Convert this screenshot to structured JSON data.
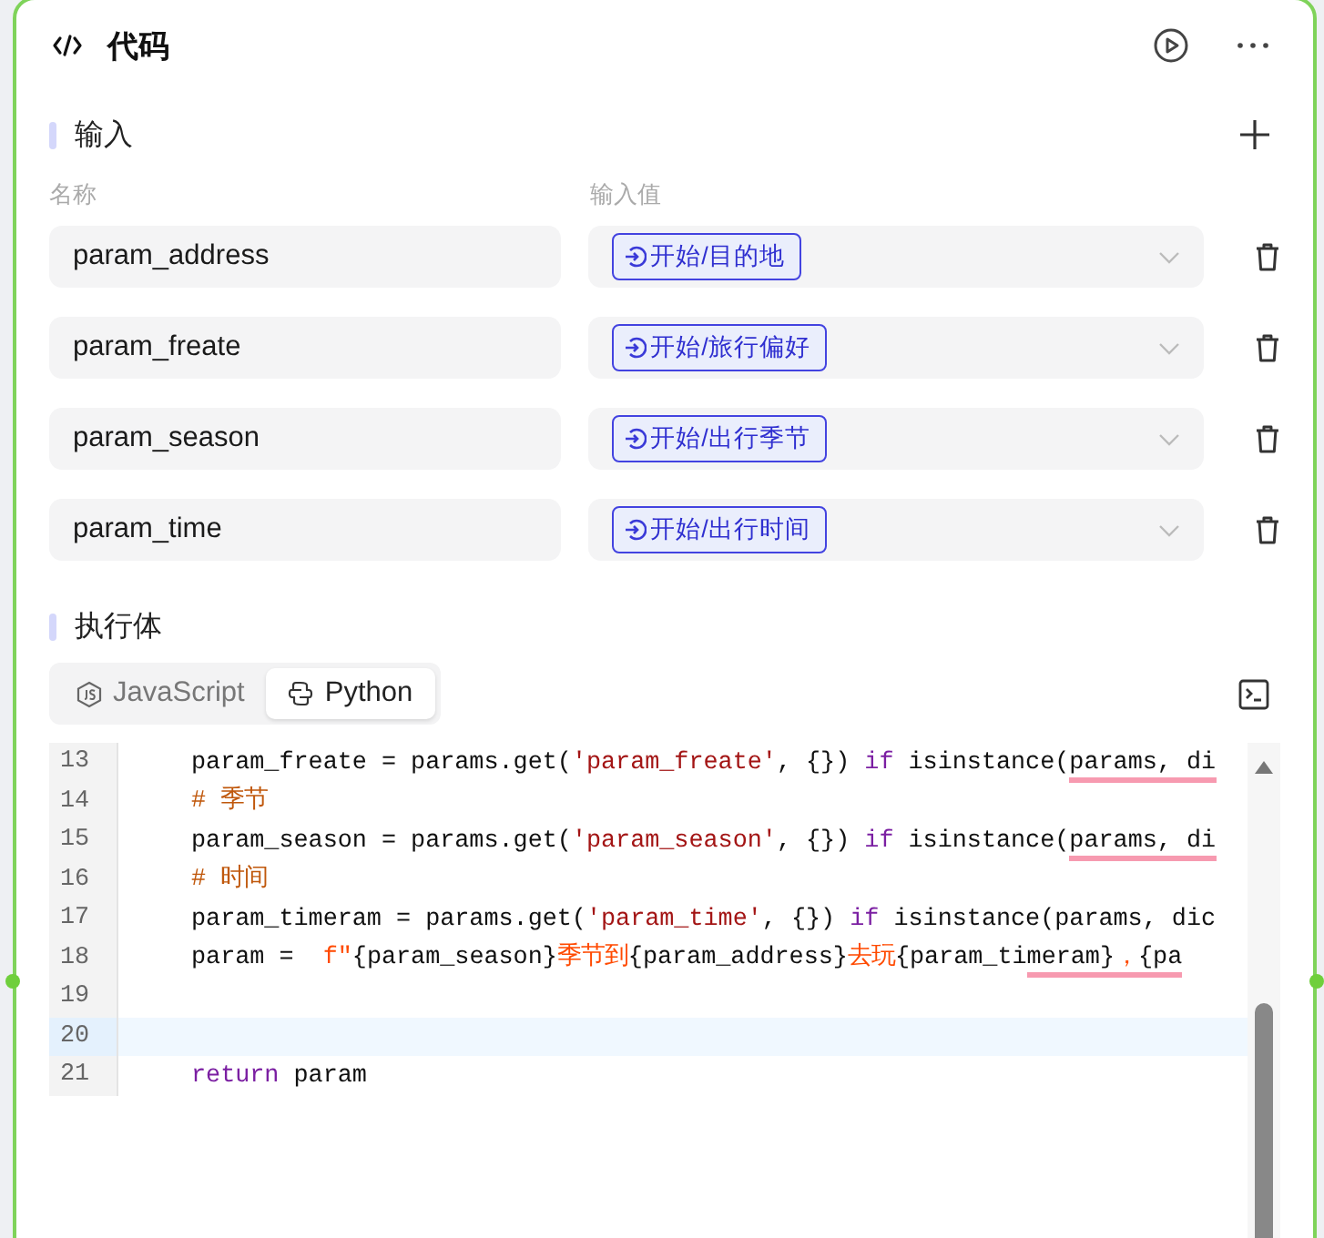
{
  "header": {
    "title": "代码"
  },
  "inputs": {
    "title": "输入",
    "columns": [
      "名称",
      "输入值"
    ],
    "rows": [
      {
        "name": "param_address",
        "value": "开始/目的地"
      },
      {
        "name": "param_freate",
        "value": "开始/旅行偏好"
      },
      {
        "name": "param_season",
        "value": "开始/出行季节"
      },
      {
        "name": "param_time",
        "value": "开始/出行时间"
      }
    ]
  },
  "body": {
    "title": "执行体",
    "tabs": [
      {
        "label": "JavaScript",
        "selected": false
      },
      {
        "label": "Python",
        "selected": true
      }
    ],
    "code": [
      {
        "number": "13",
        "active": false,
        "tokens": [
          {
            "kind": "plain",
            "text": "param_freate = params.get("
          },
          {
            "kind": "string",
            "text": "'param_freate'"
          },
          {
            "kind": "plain",
            "text": ", {}) "
          },
          {
            "kind": "keyword",
            "text": "if"
          },
          {
            "kind": "plain",
            "text": " isinstance("
          },
          {
            "kind": "plain",
            "text": "params, di",
            "flagged": true
          }
        ]
      },
      {
        "number": "14",
        "active": false,
        "tokens": [
          {
            "kind": "comment",
            "text": "# 季节"
          }
        ]
      },
      {
        "number": "15",
        "active": false,
        "tokens": [
          {
            "kind": "plain",
            "text": "param_season = params.get("
          },
          {
            "kind": "string",
            "text": "'param_season'"
          },
          {
            "kind": "plain",
            "text": ", {}) "
          },
          {
            "kind": "keyword",
            "text": "if"
          },
          {
            "kind": "plain",
            "text": " isinstance("
          },
          {
            "kind": "plain",
            "text": "params, di",
            "flagged": true
          }
        ]
      },
      {
        "number": "16",
        "active": false,
        "tokens": [
          {
            "kind": "comment",
            "text": "# 时间"
          }
        ]
      },
      {
        "number": "17",
        "active": false,
        "tokens": [
          {
            "kind": "plain",
            "text": "param_timeram = params.get("
          },
          {
            "kind": "string",
            "text": "'param_time'"
          },
          {
            "kind": "plain",
            "text": ", {}) "
          },
          {
            "kind": "keyword",
            "text": "if"
          },
          {
            "kind": "plain",
            "text": " isinstance(params, dic"
          }
        ]
      },
      {
        "number": "18",
        "active": false,
        "tokens": [
          {
            "kind": "plain",
            "text": "param =  "
          },
          {
            "kind": "fstring",
            "text": "f\""
          },
          {
            "kind": "plain",
            "text": "{param_season}"
          },
          {
            "kind": "fstring",
            "text": "季节到"
          },
          {
            "kind": "plain",
            "text": "{param_address}"
          },
          {
            "kind": "fstring",
            "text": "去玩"
          },
          {
            "kind": "plain",
            "text": "{param_ti"
          },
          {
            "kind": "plain",
            "text": "meram}",
            "flagged": true
          },
          {
            "kind": "fstring",
            "text": "，",
            "flagged": true
          },
          {
            "kind": "plain",
            "text": "{pa",
            "flagged": true
          }
        ]
      },
      {
        "number": "19",
        "active": false
      },
      {
        "number": "20",
        "active": true
      },
      {
        "number": "21",
        "active": false,
        "tokens": [
          {
            "kind": "keyword",
            "text": "return"
          },
          {
            "kind": "plain",
            "text": " param"
          }
        ]
      }
    ]
  }
}
